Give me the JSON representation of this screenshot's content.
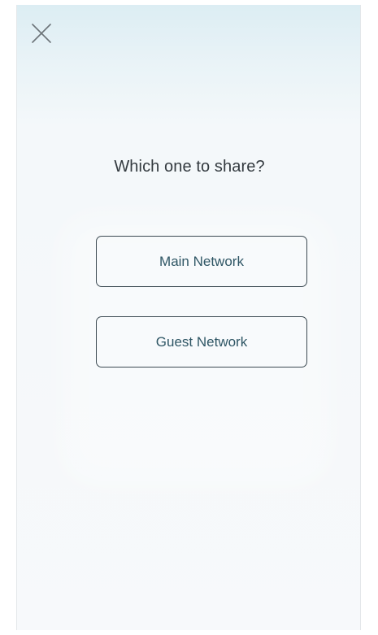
{
  "header": {
    "close_icon": "close-icon"
  },
  "dialog": {
    "title": "Which one to share?",
    "options": [
      {
        "label": "Main Network"
      },
      {
        "label": "Guest Network"
      }
    ]
  },
  "colors": {
    "title_text": "#333a3f",
    "button_text": "#2f5665",
    "button_border": "#3c4a52",
    "header_tint": "#dcedf3"
  }
}
